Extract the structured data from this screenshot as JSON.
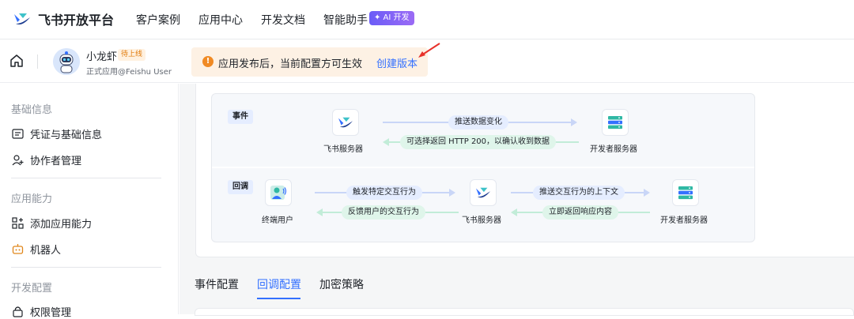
{
  "topbar": {
    "logo_text": "飞书开放平台",
    "nav": [
      "客户案例",
      "应用中心",
      "开发文档",
      "智能助手"
    ],
    "ai_badge": "✦ AI 开发"
  },
  "app": {
    "name": "小龙虾",
    "status_badge": "待上线",
    "subtitle": "正式应用@Feishu User"
  },
  "notice": {
    "text": "应用发布后，当前配置方可生效",
    "link": "创建版本"
  },
  "sidebar": {
    "sections": [
      {
        "title": "基础信息",
        "items": [
          "凭证与基础信息",
          "协作者管理"
        ]
      },
      {
        "title": "应用能力",
        "items": [
          "添加应用能力",
          "机器人"
        ]
      },
      {
        "title": "开发配置",
        "items": [
          "权限管理"
        ]
      }
    ]
  },
  "flow": {
    "event": {
      "tag": "事件",
      "left_node": "飞书服务器",
      "right_node": "开发者服务器",
      "forward": "推送数据变化",
      "backward": "可选择返回 HTTP 200，以确认收到数据"
    },
    "callback": {
      "tag": "回调",
      "user_node": "终端用户",
      "middle_node": "飞书服务器",
      "right_node": "开发者服务器",
      "forward1": "触发特定交互行为",
      "backward1": "反馈用户的交互行为",
      "forward2": "推送交互行为的上下文",
      "backward2": "立即返回响应内容"
    }
  },
  "tabs": [
    "事件配置",
    "回调配置",
    "加密策略"
  ],
  "active_tab": "回调配置",
  "colors": {
    "accent": "#3370ff",
    "warning": "#f08a24",
    "ai": "#7b61f8"
  }
}
